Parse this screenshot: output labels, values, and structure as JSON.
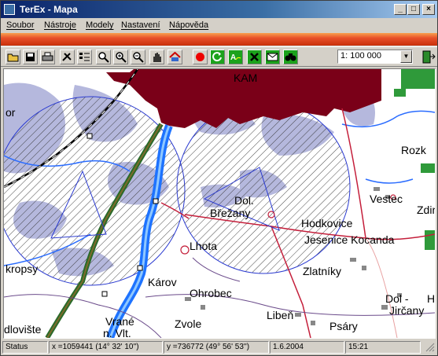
{
  "window": {
    "title": "TerEx  - Mapa"
  },
  "menu": [
    {
      "label": "Soubor"
    },
    {
      "label": "Nástroje"
    },
    {
      "label": "Modely"
    },
    {
      "label": "Nastavení"
    },
    {
      "label": "Nápověda"
    }
  ],
  "toolbar": {
    "scale_value": "1:  100 000",
    "buttons": [
      "open-icon",
      "save-icon",
      "print-icon",
      "tools-icon",
      "layers-icon",
      "zoom-icon",
      "zoom-in-icon",
      "zoom-out-icon",
      "pan-hand-icon",
      "home-icon",
      "record-icon",
      "refresh-icon",
      "text-edit-icon",
      "cancel-icon",
      "mail-icon",
      "binoculars-icon"
    ]
  },
  "map": {
    "labels": {
      "kam": "KAM",
      "or": "or",
      "dol_brezany_1": "Dol.",
      "dol_brezany_2": "Břežany",
      "hodkovice": "Hodkovice",
      "vestec": "Vestec",
      "zdir": "Zdir",
      "rozk": "Rozk",
      "lhota": "Lhota",
      "jesenice": "Jesenice Kocanda",
      "kropsy": "kropsy",
      "zlatniky": "Zlatníky",
      "karov": "Károv",
      "ohrobec": "Ohrobec",
      "vrane_1": "Vrané",
      "vrane_2": "n. Vlt.",
      "zvole": "Zvole",
      "liben": "Libeň",
      "psary": "Psáry",
      "dol_jircany_1": "Dol -",
      "dol_jircany_2": "Jirčany",
      "h": "H",
      "dlovište": "dlovište"
    }
  },
  "status": {
    "label": "Status",
    "x": "x =1059441 (14° 32' 10'')",
    "y": "y =736772 (49° 56' 53'')",
    "date": "1.6.2004",
    "time": "15:21"
  }
}
